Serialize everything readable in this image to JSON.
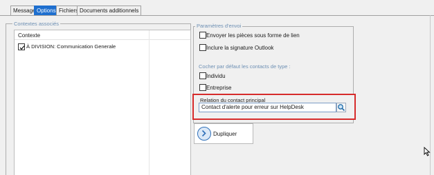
{
  "tabs": [
    {
      "label": "Message",
      "active": false
    },
    {
      "label": "Options",
      "active": true
    },
    {
      "label": "Fichiers",
      "active": false
    },
    {
      "label": "Documents additionnels",
      "active": false
    }
  ],
  "contexts": {
    "group_title": "Contextes associés",
    "column_header": "Contexte",
    "rows": [
      {
        "label": "À DIVISION: Communication Generale",
        "checked": true
      }
    ]
  },
  "send_params": {
    "group_title": "Paramètres d'envoi",
    "send_as_link": {
      "label": "Envoyer les pièces sous forme de lien",
      "checked": false
    },
    "include_signature": {
      "label": "Inclure la signature Outlook",
      "checked": false
    },
    "default_contacts_title": "Cocher par défaut les contacts de type :",
    "individual": {
      "label": "Individu",
      "checked": false
    },
    "company": {
      "label": "Entreprise",
      "checked": false
    }
  },
  "relation": {
    "label": "Relation du contact principal",
    "value": "Contact d'alerte pour erreur sur HelpDesk",
    "search_icon": "search-icon"
  },
  "duplicate": {
    "label": "Dupliquer",
    "icon": "arrow-right-circle-icon"
  },
  "colors": {
    "active_tab": "#1e6fcf",
    "highlight_border": "#d62a2a",
    "group_caption": "#6d8fb3"
  }
}
